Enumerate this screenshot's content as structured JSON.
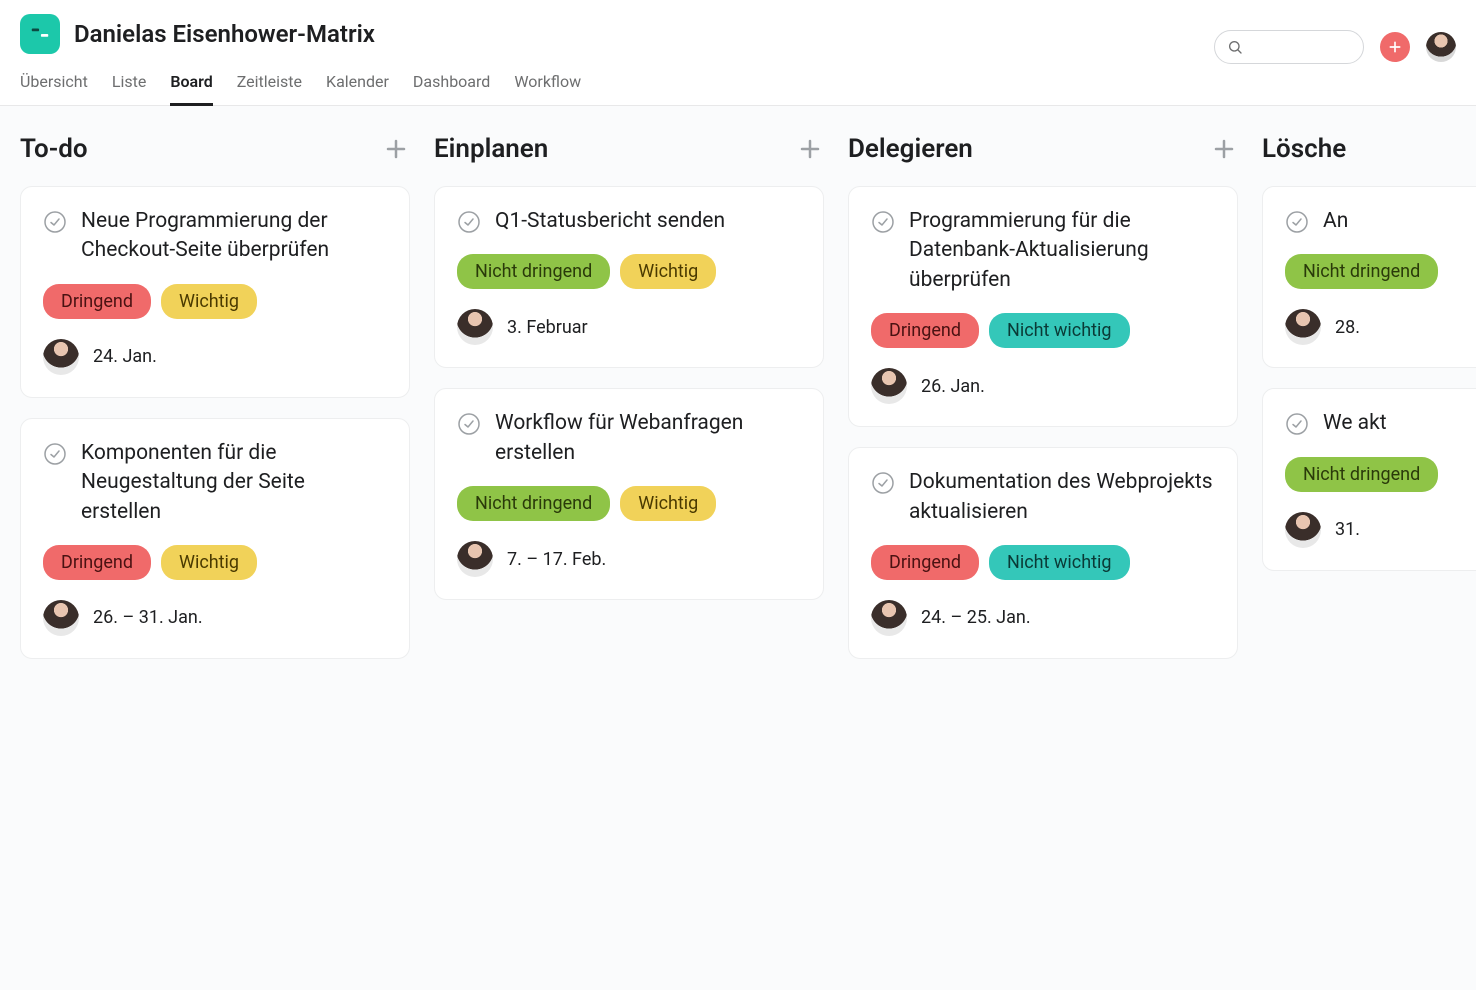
{
  "project": {
    "title": "Danielas Eisenhower-Matrix"
  },
  "tabs": [
    {
      "label": "Übersicht",
      "active": false
    },
    {
      "label": "Liste",
      "active": false
    },
    {
      "label": "Board",
      "active": true
    },
    {
      "label": "Zeitleiste",
      "active": false
    },
    {
      "label": "Kalender",
      "active": false
    },
    {
      "label": "Dashboard",
      "active": false
    },
    {
      "label": "Workflow",
      "active": false
    }
  ],
  "tag_labels": {
    "dringend": "Dringend",
    "wichtig": "Wichtig",
    "nicht_dringend": "Nicht dringend",
    "nicht_wichtig": "Nicht wichtig"
  },
  "columns": [
    {
      "title": "To-do",
      "cards": [
        {
          "title": "Neue Programmierung der Checkout-Seite überprüfen",
          "tags": [
            "dringend",
            "wichtig"
          ],
          "date": "24. Jan."
        },
        {
          "title": "Komponenten für die Neugestaltung der Seite erstellen",
          "tags": [
            "dringend",
            "wichtig"
          ],
          "date": "26. – 31. Jan."
        }
      ]
    },
    {
      "title": "Einplanen",
      "cards": [
        {
          "title": "Q1-Statusbericht senden",
          "tags": [
            "nicht_dringend",
            "wichtig"
          ],
          "date": "3. Februar"
        },
        {
          "title": "Workflow für Webanfragen erstellen",
          "tags": [
            "nicht_dringend",
            "wichtig"
          ],
          "date": "7. – 17. Feb."
        }
      ]
    },
    {
      "title": "Delegieren",
      "cards": [
        {
          "title": "Programmierung für die Datenbank-Aktualisierung überprüfen",
          "tags": [
            "dringend",
            "nicht_wichtig"
          ],
          "date": "26. Jan."
        },
        {
          "title": "Dokumentation des Webprojekts aktualisieren",
          "tags": [
            "dringend",
            "nicht_wichtig"
          ],
          "date": "24. – 25. Jan."
        }
      ]
    },
    {
      "title": "Lösche",
      "cards": [
        {
          "title": "An",
          "tags": [
            "nicht_dringend"
          ],
          "date": "28."
        },
        {
          "title": "We akt",
          "tags": [
            "nicht_dringend"
          ],
          "date": "31."
        }
      ]
    }
  ]
}
